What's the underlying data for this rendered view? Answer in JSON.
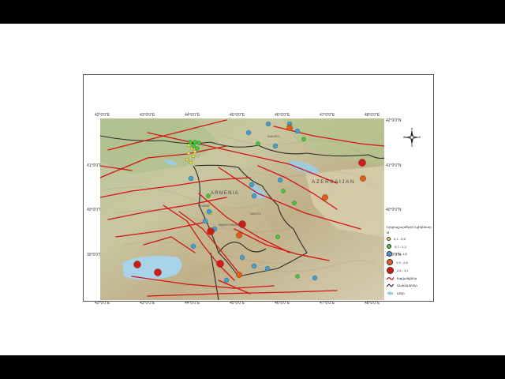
{
  "map": {
    "lat_labels_left": [
      "41°0'0\"N",
      "40°0'0\"N",
      "39°0'0\"N"
    ],
    "lat_labels_right": [
      "42°0'0\"N",
      "41°0'0\"N",
      "40°0'0\"N",
      "39°0'0\"N"
    ],
    "lon_labels_top": [
      "42°0'0\"E",
      "43°0'0\"E",
      "44°0'0\"E",
      "45°0'0\"E",
      "46°0'0\"E",
      "47°0'0\"E",
      "48°0'0\"E"
    ],
    "lon_labels_bottom": [
      "42°0'0\"E",
      "43°0'0\"E",
      "44°0'0\"E",
      "45°0'0\"E",
      "46°0'0\"E",
      "47°0'0\"E",
      "48°0'0\"E"
    ],
    "place_labels": [
      "AZERBAIJAN",
      "ARMENIA",
      "NAKHCHIVAN",
      "KAKHETI",
      "VAYOTS",
      "ARARAT"
    ],
    "compass": {
      "n": "N",
      "s": "S",
      "e": "E",
      "w": "W"
    }
  },
  "legend": {
    "title": "Երկրաշարժերի էպիկենտր",
    "m_label": "M",
    "classes": [
      {
        "label": "0,1 - 0,6",
        "color": "#f2e23a"
      },
      {
        "label": "0,7 - 1,2",
        "color": "#3fca2e"
      },
      {
        "label": "1,3 - 1,8",
        "color": "#3f9fd0"
      },
      {
        "label": "1,9 - 2,6",
        "color": "#e25d18"
      },
      {
        "label": "2,6 - 3,1",
        "color": "#d11a1a"
      }
    ],
    "fault_label": "Խզվածքներ",
    "border_label": "Սահմաններ",
    "water_label": "Լճեր"
  }
}
